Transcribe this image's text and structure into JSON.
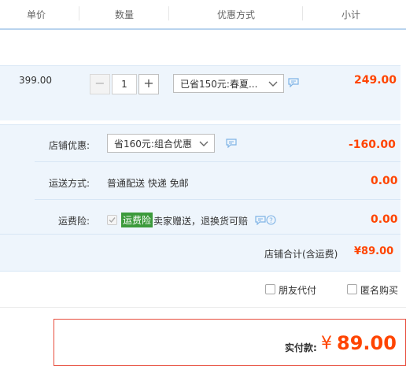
{
  "header": {
    "col_price": "单价",
    "col_qty": "数量",
    "col_discount": "优惠方式",
    "col_subtotal": "小计"
  },
  "item": {
    "unit_price": "399.00",
    "quantity": "1",
    "minus": "−",
    "plus": "+",
    "promo_select": "已省150元:春夏...",
    "subtotal": "249.00"
  },
  "shop": {
    "discount_label": "店铺优惠:",
    "discount_select": "省160元:组合优惠",
    "discount_value": "-160.00",
    "shipping_label": "运送方式:",
    "shipping_text": "普通配送 快递 免邮",
    "shipping_value": "0.00",
    "insurance_label": "运费险:",
    "insurance_tag": "运费险",
    "insurance_text": "卖家赠送，退换货可赔",
    "insurance_value": "0.00",
    "total_label": "店铺合计(含运费)",
    "total_value": "¥89.00"
  },
  "options": {
    "friend_pay": "朋友代付",
    "anonymous": "匿名购买"
  },
  "payment": {
    "label": "实付款:",
    "currency": "¥",
    "amount": "89.00"
  },
  "colors": {
    "accent_red": "#ff4400",
    "band_blue": "#eef5fc",
    "tag_green": "#3c9a3c"
  }
}
